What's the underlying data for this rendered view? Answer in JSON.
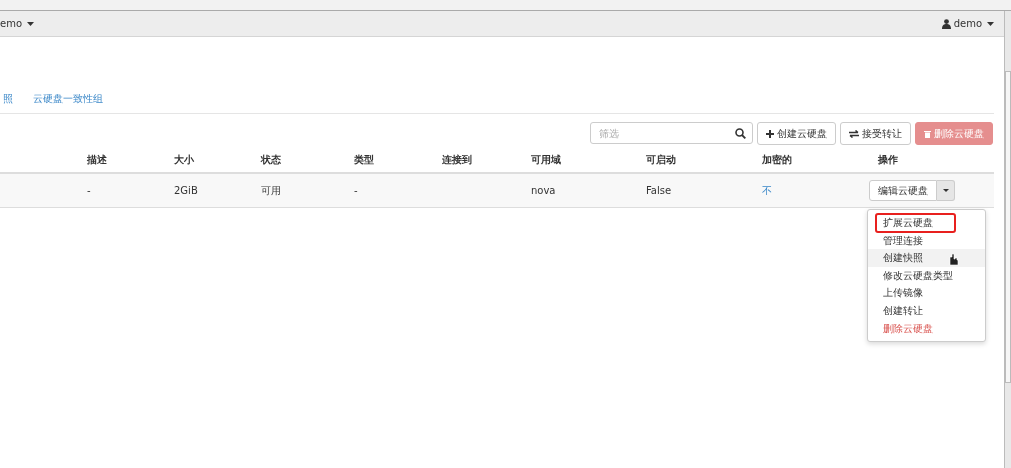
{
  "navbar": {
    "project": "emo",
    "user": "demo"
  },
  "tabs": [
    {
      "label": "照",
      "selected": false
    },
    {
      "label": "云硬盘一致性组",
      "selected": false
    }
  ],
  "toolbar": {
    "filter": {
      "placeholder": "筛选"
    },
    "buttons": [
      {
        "label": "创建云硬盘",
        "kind": "create"
      },
      {
        "label": "接受转让",
        "kind": "transfer"
      },
      {
        "label": "删除云硬盘",
        "kind": "delete"
      }
    ]
  },
  "table": {
    "columns": [
      "描述",
      "大小",
      "状态",
      "类型",
      "连接到",
      "可用域",
      "可启动",
      "加密的",
      "操作"
    ],
    "rows": [
      {
        "cells": [
          "-",
          "2GiB",
          "可用",
          "-",
          "",
          "nova",
          "False"
        ],
        "encrypted": "不",
        "action": "编辑云硬盘"
      }
    ]
  },
  "menu": {
    "items": [
      {
        "label": "扩展云硬盘",
        "hovered": false,
        "danger": false,
        "highlighted": true
      },
      {
        "label": "管理连接",
        "hovered": false,
        "danger": false,
        "highlighted": false
      },
      {
        "label": "创建快照",
        "hovered": true,
        "danger": false,
        "highlighted": false
      },
      {
        "label": "修改云硬盘类型",
        "hovered": false,
        "danger": false,
        "highlighted": false
      },
      {
        "label": "上传镜像",
        "hovered": false,
        "danger": false,
        "highlighted": false
      },
      {
        "label": "创建转让",
        "hovered": false,
        "danger": false,
        "highlighted": false
      },
      {
        "label": "删除云硬盘",
        "hovered": false,
        "danger": true,
        "highlighted": false
      }
    ]
  }
}
